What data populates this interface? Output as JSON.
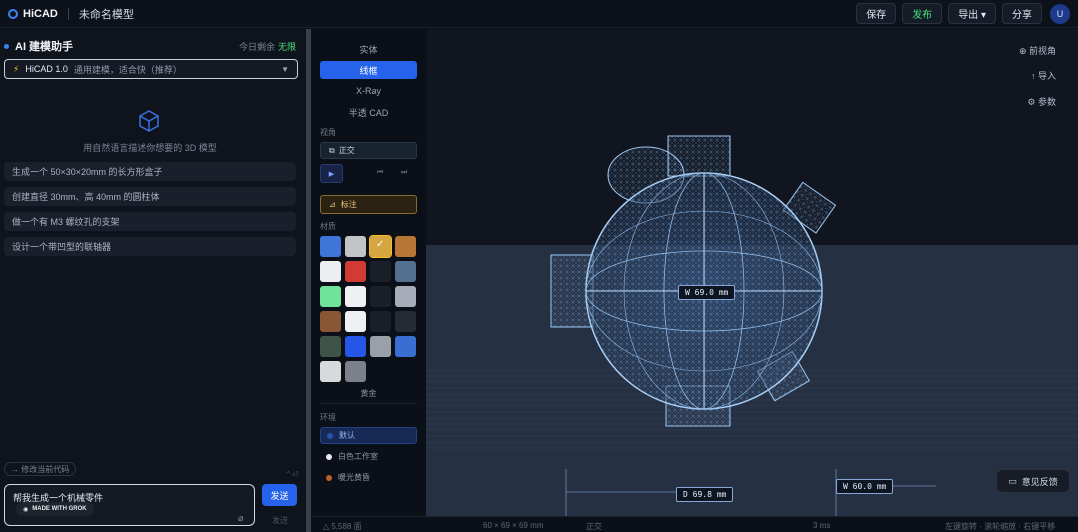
{
  "header": {
    "logo": "HiCAD",
    "model_name": "未命名模型",
    "buttons": {
      "save": "保存",
      "publish": "发布",
      "export": "导出 ▾",
      "share": "分享"
    },
    "avatar": "U"
  },
  "assistant": {
    "title": "AI 建模助手",
    "usage_label": "今日剩余",
    "usage_value": "无限",
    "model_name": "HiCAD 1.0",
    "model_desc": "通用建模，适合快（推荐）",
    "empty_text": "用自然语言描述你想要的 3D 模型",
    "suggestions": [
      "生成一个 50×30×20mm 的长方形盒子",
      "创建直径 30mm、高 40mm 的圆柱体",
      "做一个有 M3 螺纹孔的支架",
      "设计一个带凹型的联轴器"
    ],
    "code_chip": "→ 修改当前代码",
    "input_text": "帮我生成一个机械零件",
    "grok_badge": "MADE WITH GROK",
    "send": "发送",
    "send_hint": "发送"
  },
  "tools": {
    "modes": [
      "实体",
      "线框",
      "X-Ray",
      "半透 CAD"
    ],
    "active_mode": "线框",
    "view_label": "视角",
    "view_button": "正交",
    "annotate": "标注",
    "material_label": "材质",
    "swatch_colors": [
      [
        "#3f75d8",
        "#c2c4c8",
        "#d4a742",
        "#b87636"
      ],
      [
        "#eceef2",
        "#d13a35",
        "#1a1f2a",
        "#55708f"
      ],
      [
        "#6fe39a",
        "#eef0f4",
        "#1a1f2a",
        "#a6adb8"
      ],
      [
        "#8a5634",
        "#eff0f3",
        "#1a1f2a",
        "#262b33"
      ],
      [
        "#3d5348",
        "#2456e8",
        "#9aa0a8",
        "#3a6ed2"
      ],
      [
        "#d8d9dc",
        "#7b808a"
      ]
    ],
    "material_name": "黄金",
    "env_label": "环境",
    "env_options": [
      "默认",
      "白色工作室",
      "暖光黄昏"
    ]
  },
  "viewport": {
    "menu": [
      "⊕ 前视角",
      "↑ 导入",
      "⚙ 参数"
    ],
    "dim_labels": [
      "W 69.0 mm",
      "D 69.8 mm",
      "W 60.0 mm"
    ],
    "feedback": "意见反馈"
  },
  "status": {
    "faces": "△ 5,588 面",
    "size": "60 × 69 × 69 mm",
    "view": "正交",
    "fps": "3 ms",
    "hint": "左键旋转 · 滚轮缩放 · 右键平移"
  }
}
